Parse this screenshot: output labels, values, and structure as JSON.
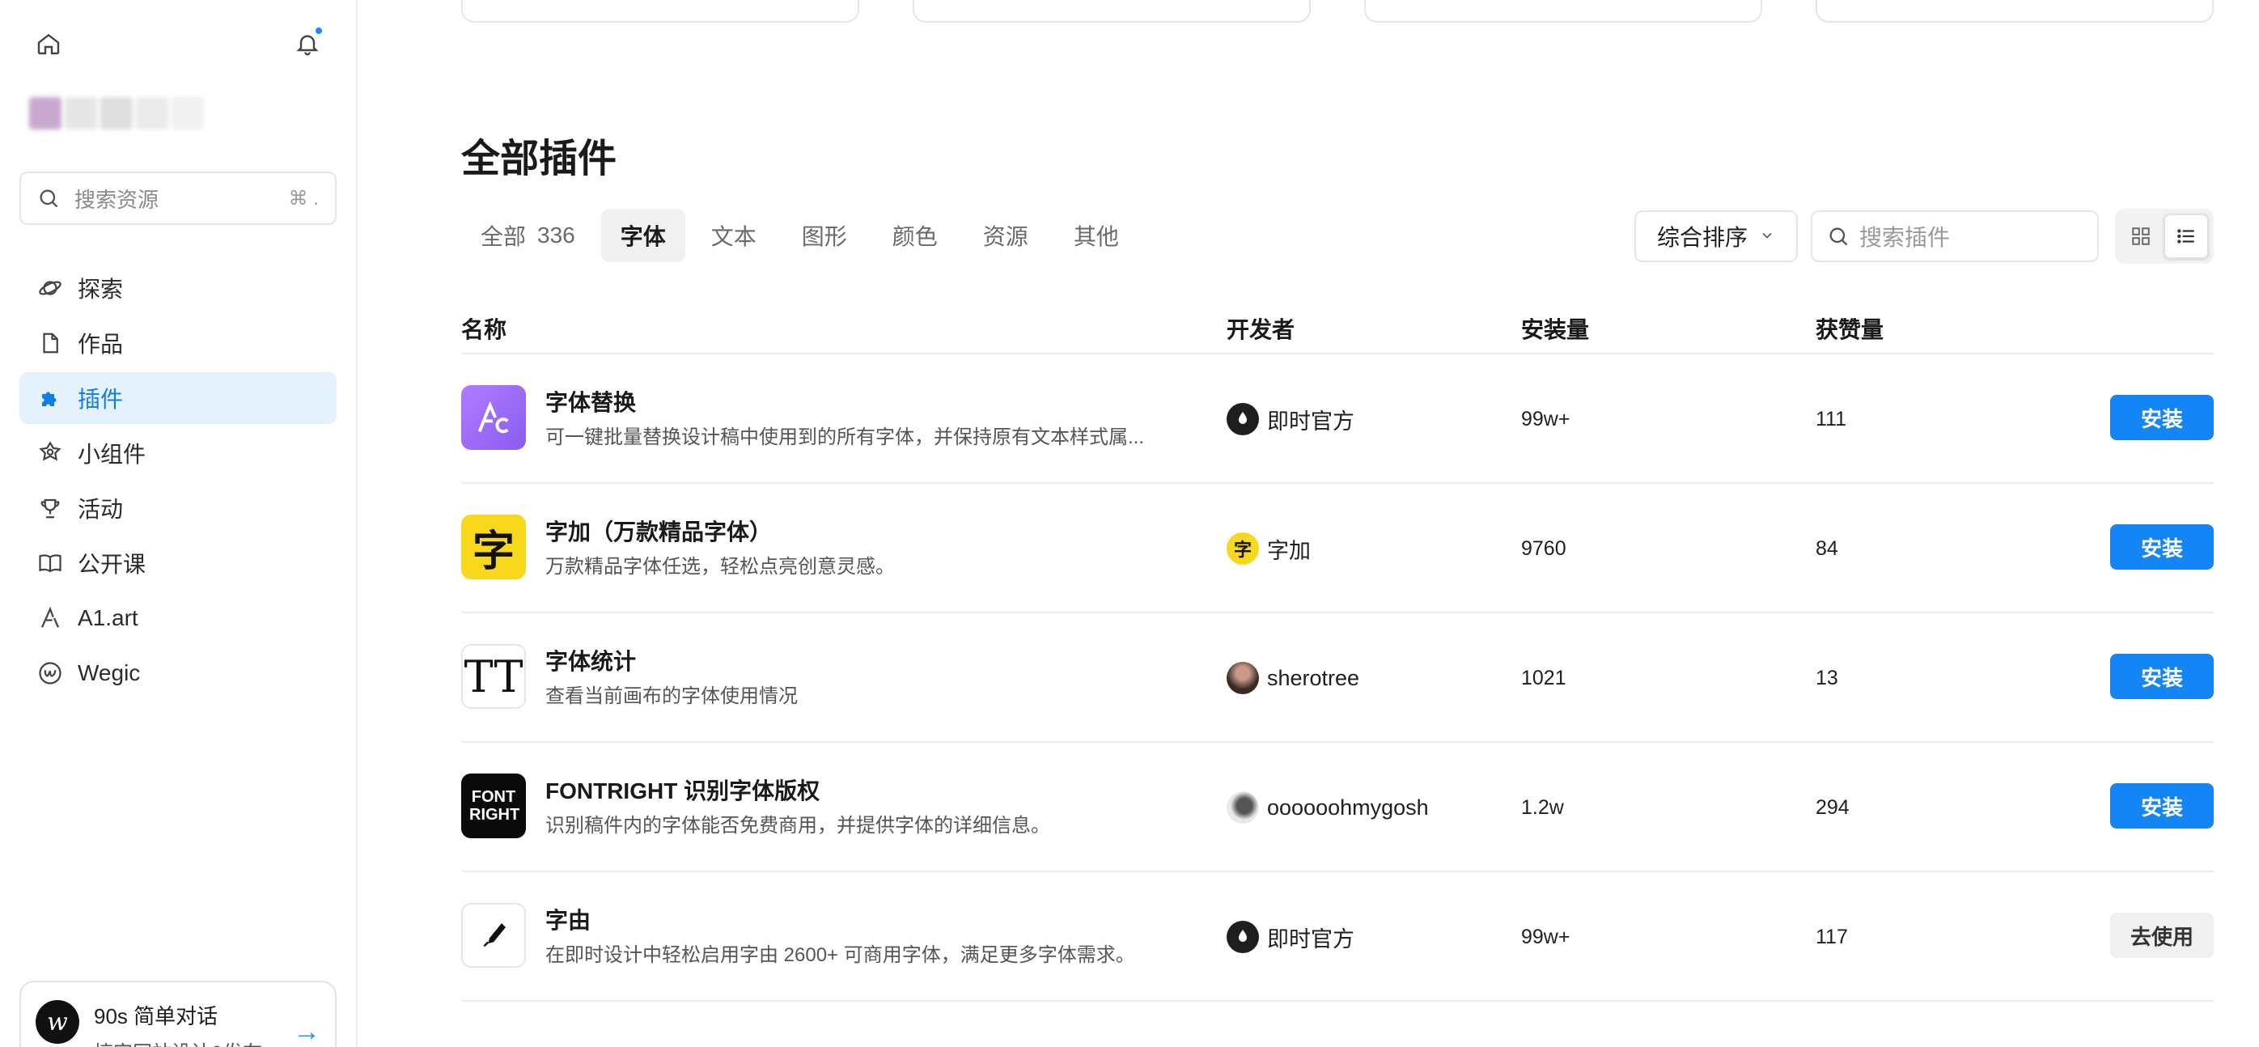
{
  "sidebar": {
    "search_placeholder": "搜索资源",
    "search_shortcut": "⌘ .",
    "nav": [
      {
        "label": "探索",
        "icon": "planet-icon"
      },
      {
        "label": "作品",
        "icon": "file-icon"
      },
      {
        "label": "插件",
        "icon": "puzzle-icon",
        "active": true
      },
      {
        "label": "小组件",
        "icon": "widget-icon"
      },
      {
        "label": "活动",
        "icon": "trophy-icon"
      },
      {
        "label": "公开课",
        "icon": "book-icon"
      },
      {
        "label": "A1.art",
        "icon": "a1-art-icon"
      },
      {
        "label": "Wegic",
        "icon": "wegic-icon"
      }
    ],
    "promo": {
      "title": "90s 简单对话",
      "subtitle": "搞定网站设计&发布"
    }
  },
  "main": {
    "title": "全部插件",
    "tabs": [
      {
        "label": "全部",
        "count": "336"
      },
      {
        "label": "字体",
        "active": true
      },
      {
        "label": "文本"
      },
      {
        "label": "图形"
      },
      {
        "label": "颜色"
      },
      {
        "label": "资源"
      },
      {
        "label": "其他"
      }
    ],
    "sort_label": "综合排序",
    "search_placeholder": "搜索插件",
    "columns": {
      "name": "名称",
      "developer": "开发者",
      "installs": "安装量",
      "likes": "获赞量"
    },
    "plugins": [
      {
        "name": "字体替换",
        "desc": "可一键批量替换设计稿中使用到的所有字体，并保持原有文本样式属...",
        "developer": "即时官方",
        "installs": "99w+",
        "likes": "111",
        "action": "安装"
      },
      {
        "name": "字加（万款精品字体）",
        "desc": "万款精品字体任选，轻松点亮创意灵感。",
        "developer": "字加",
        "installs": "9760",
        "likes": "84",
        "action": "安装",
        "icon_text": "字"
      },
      {
        "name": "字体统计",
        "desc": "查看当前画布的字体使用情况",
        "developer": "sherotree",
        "installs": "1021",
        "likes": "13",
        "action": "安装",
        "icon_text": "TT"
      },
      {
        "name": "FONTRIGHT 识别字体版权",
        "desc": "识别稿件内的字体能否免费商用，并提供字体的详细信息。",
        "developer": "oooooohmygosh",
        "installs": "1.2w",
        "likes": "294",
        "action": "安装",
        "icon_text": "FONT RIGHT"
      },
      {
        "name": "字由",
        "desc": "在即时设计中轻松启用字由 2600+ 可商用字体，满足更多字体需求。",
        "developer": "即时官方",
        "installs": "99w+",
        "likes": "117",
        "action": "去使用"
      }
    ]
  },
  "colors": {
    "accent": "#1485f5",
    "active_nav_bg": "#e5f1fd"
  }
}
